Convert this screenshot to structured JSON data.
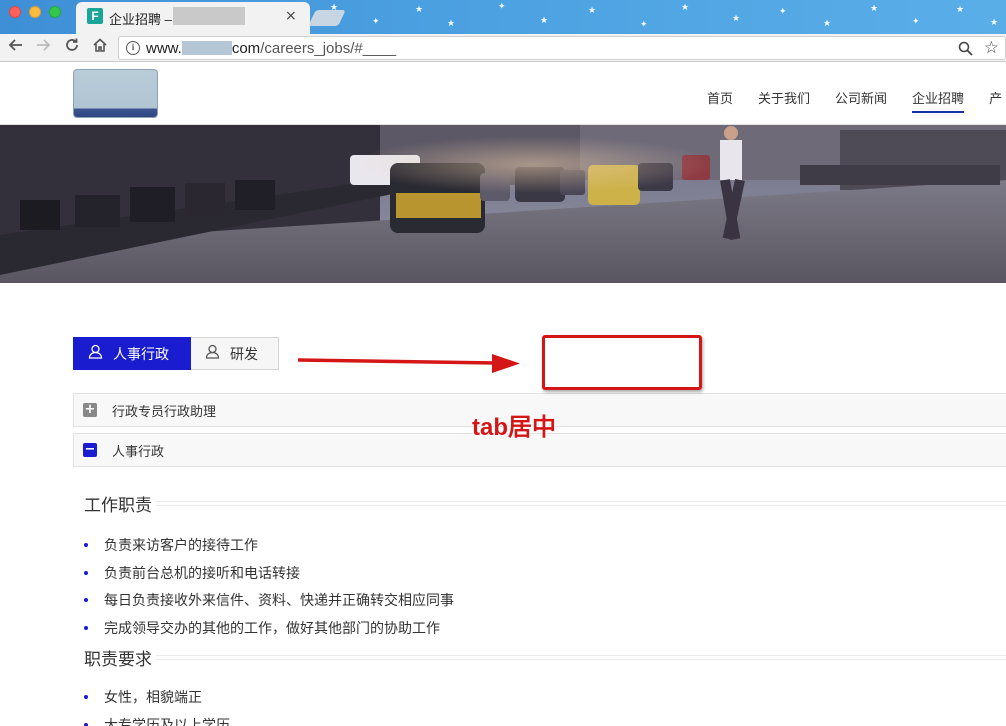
{
  "browser": {
    "tab": {
      "favicon_letter": "F",
      "title": "企业招聘 –",
      "close_glyph": "×"
    },
    "address": {
      "prefix": "www.",
      "domain_suffix": "com",
      "path": "/careers_jobs/#____"
    }
  },
  "site": {
    "nav": [
      {
        "label": "首页"
      },
      {
        "label": "关于我们"
      },
      {
        "label": "公司新闻"
      },
      {
        "label": "企业招聘",
        "active": true
      },
      {
        "label": "产"
      }
    ]
  },
  "tabs": [
    {
      "label": "人事行政",
      "active": true
    },
    {
      "label": "研发",
      "active": false
    }
  ],
  "accordion": [
    {
      "label": "行政专员行政助理",
      "state": "collapsed"
    },
    {
      "label": "人事行政",
      "state": "expanded"
    }
  ],
  "job": {
    "duties_title": "工作职责",
    "duties": [
      "负责来访客户的接待工作",
      "负责前台总机的接听和电话转接",
      "每日负责接收外来信件、资料、快递并正确转交相应同事",
      "完成领导交办的其他的工作，做好其他部门的协助工作"
    ],
    "requirements_title": "职责要求",
    "requirements": [
      "女性，相貌端正",
      "大专学历及以上学历"
    ]
  },
  "annotation": {
    "text": "tab居中",
    "color": "#d41616"
  },
  "colors": {
    "accent": "#1a1ccf",
    "nav_underline": "#1a2fa8"
  }
}
